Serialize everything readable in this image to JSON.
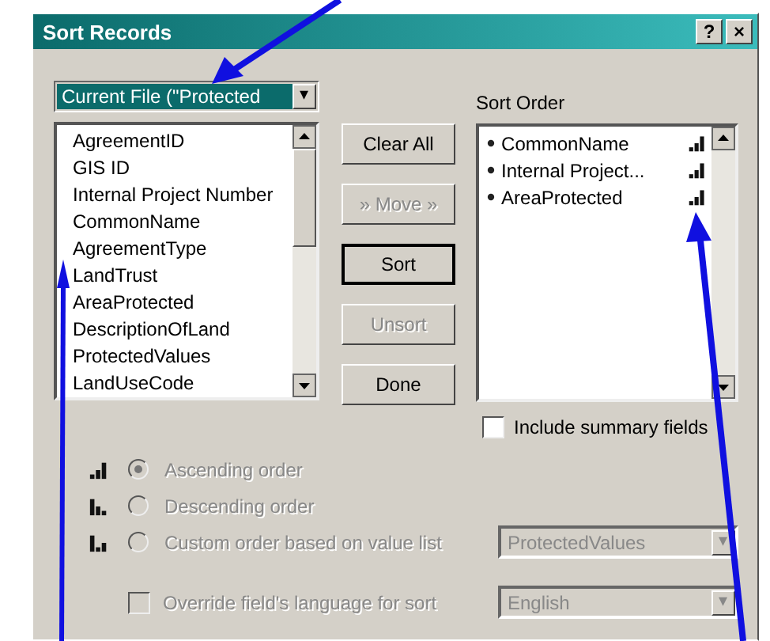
{
  "window": {
    "title": "Sort Records",
    "help": "?",
    "close": "×"
  },
  "file_selector": {
    "value": "Current File (\"Protected",
    "arrow": "▾"
  },
  "fields": [
    "AgreementID",
    "GIS ID",
    "Internal Project Number",
    "CommonName",
    "AgreementType",
    "LandTrust",
    "AreaProtected",
    "DescriptionOfLand",
    "ProtectedValues",
    "LandUseCode"
  ],
  "buttons": [
    {
      "label": "Clear All",
      "disabled": false,
      "default": false
    },
    {
      "label": "» Move »",
      "disabled": true,
      "default": false
    },
    {
      "label": "Sort",
      "disabled": false,
      "default": true
    },
    {
      "label": "Unsort",
      "disabled": true,
      "default": false
    },
    {
      "label": "Done",
      "disabled": false,
      "default": false
    }
  ],
  "sort_order": {
    "label": "Sort Order",
    "items": [
      {
        "name": "CommonName",
        "kind": "ascending"
      },
      {
        "name": "Internal Project...",
        "kind": "ascending"
      },
      {
        "name": "AreaProtected",
        "kind": "ascending"
      }
    ]
  },
  "include_summary": {
    "label": "Include summary fields",
    "checked": false,
    "disabled": false
  },
  "order_options": [
    {
      "kind": "ascending",
      "label": "Ascending order",
      "selected": true,
      "disabled": true
    },
    {
      "kind": "descending",
      "label": "Descending order",
      "selected": false,
      "disabled": true
    },
    {
      "kind": "custom",
      "label": "Custom order based on value list",
      "selected": false,
      "disabled": true
    }
  ],
  "value_list": {
    "value": "ProtectedValues",
    "disabled": true
  },
  "override_language": {
    "label": "Override field's language for sort",
    "checked": false,
    "disabled": true
  },
  "language": {
    "value": "English",
    "disabled": true
  }
}
